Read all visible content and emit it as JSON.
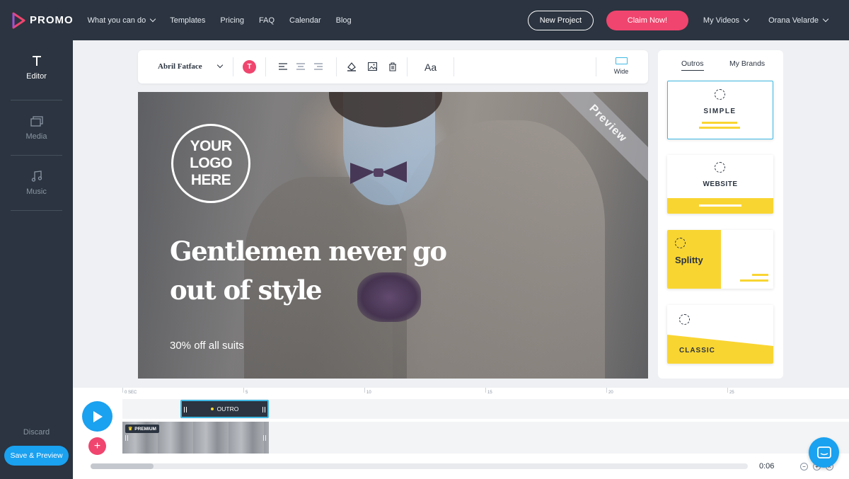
{
  "brand": {
    "name": "PROMO",
    "accent": "#f0456e",
    "primary": "#1aa1f0",
    "dark": "#2b3440"
  },
  "nav": {
    "items": [
      "What you can do",
      "Templates",
      "Pricing",
      "FAQ",
      "Calendar",
      "Blog"
    ],
    "new_project": "New Project",
    "claim": "Claim Now!",
    "my_videos": "My Videos",
    "user": "Orana Velarde"
  },
  "sidebar": {
    "items": [
      {
        "label": "Editor",
        "icon": "text-icon"
      },
      {
        "label": "Media",
        "icon": "media-icon"
      },
      {
        "label": "Music",
        "icon": "music-icon"
      }
    ],
    "discard": "Discard",
    "save": "Save & Preview"
  },
  "toolbar": {
    "font": "Abril Fatface",
    "color_label": "T",
    "case": "Aa",
    "wide": "Wide"
  },
  "preview": {
    "logo_lines": [
      "YOUR",
      "LOGO",
      "HERE"
    ],
    "headline": "Gentlemen never go out of style",
    "subline": "30% off all suits",
    "watermark": "Preview"
  },
  "panel": {
    "tabs": [
      "Outros",
      "My Brands"
    ],
    "cards": [
      "SIMPLE",
      "WEBSITE",
      "Splitty",
      "CLASSIC"
    ]
  },
  "timeline": {
    "ticks": [
      "0 SEC",
      "5",
      "10",
      "15",
      "20",
      "25"
    ],
    "clip_label": "OUTRO",
    "premium": "PREMIUM",
    "time": "0:06",
    "scroll_fraction": 0.096
  }
}
